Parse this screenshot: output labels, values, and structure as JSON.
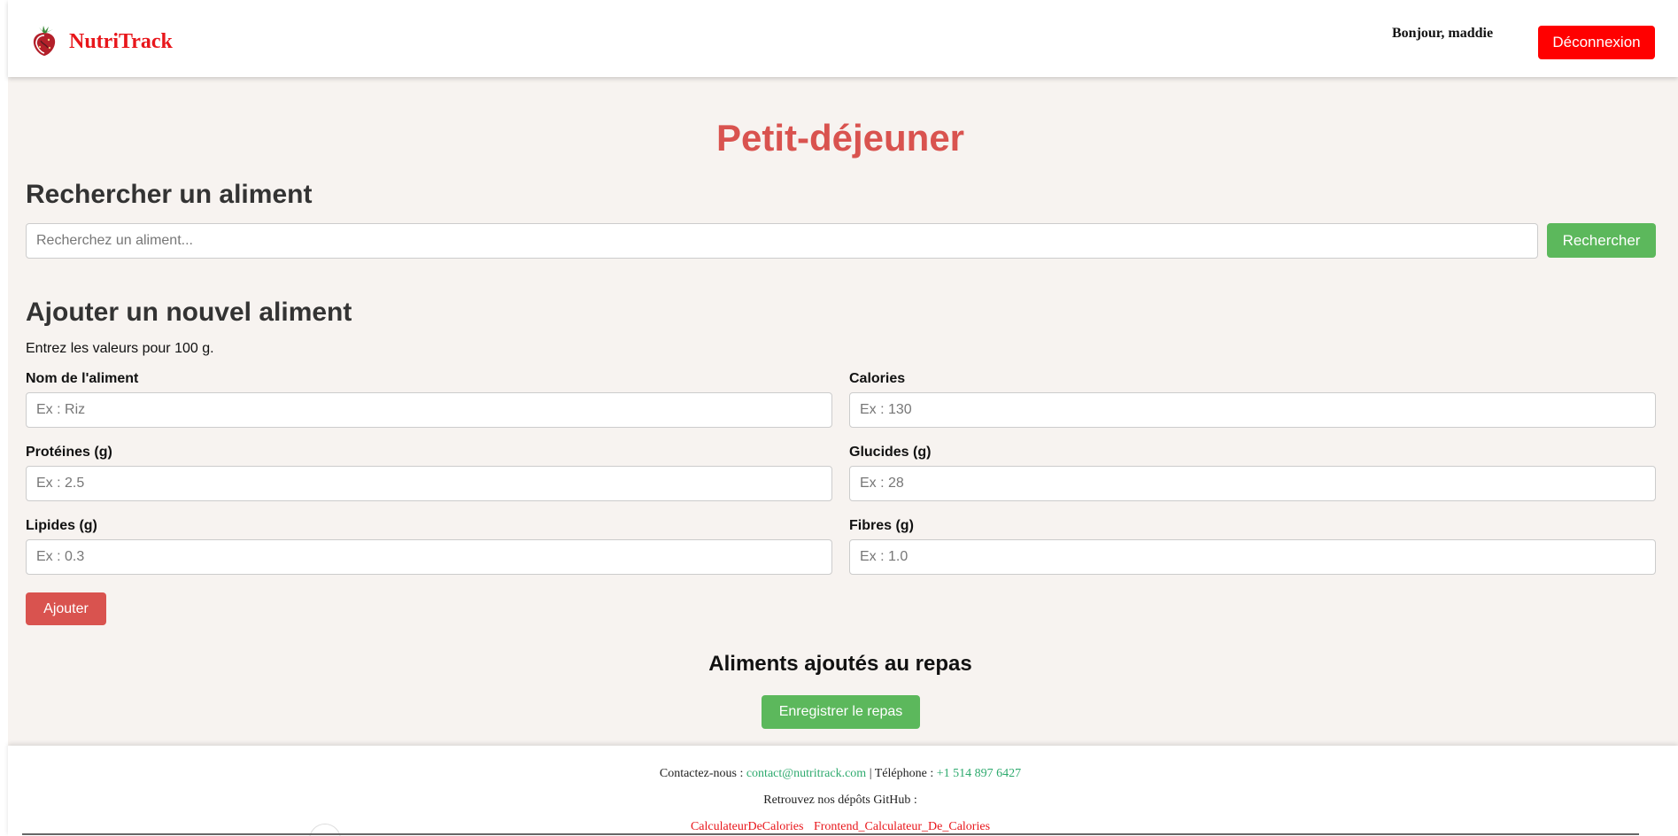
{
  "header": {
    "brand": "NutriTrack",
    "greeting": "Bonjour, maddie",
    "logout_label": "Déconnexion",
    "colors": {
      "brand": "#e8161b",
      "logout": "#ff0000"
    }
  },
  "main": {
    "meal_title": "Petit-déjeuner",
    "search": {
      "title": "Rechercher un aliment",
      "placeholder": "Recherchez un aliment...",
      "value": "",
      "button_label": "Rechercher"
    },
    "add_food": {
      "title": "Ajouter un nouvel aliment",
      "hint": "Entrez les valeurs pour 100 g.",
      "fields": [
        {
          "label": "Nom de l'aliment",
          "placeholder": "Ex : Riz",
          "value": ""
        },
        {
          "label": "Calories",
          "placeholder": "Ex : 130",
          "value": ""
        },
        {
          "label": "Protéines (g)",
          "placeholder": "Ex : 2.5",
          "value": ""
        },
        {
          "label": "Glucides (g)",
          "placeholder": "Ex : 28",
          "value": ""
        },
        {
          "label": "Lipides (g)",
          "placeholder": "Ex : 0.3",
          "value": ""
        },
        {
          "label": "Fibres (g)",
          "placeholder": "Ex : 1.0",
          "value": ""
        }
      ],
      "add_button_label": "Ajouter"
    },
    "meal_items": {
      "title": "Aliments ajoutés au repas",
      "items": [],
      "save_button_label": "Enregistrer le repas"
    },
    "colors": {
      "title": "#d9534f",
      "primary_green": "#5cb85c",
      "danger": "#d9534f"
    }
  },
  "footer": {
    "contact_prefix": "Contactez-nous :",
    "email": "contact@nutritrack.com",
    "separator": "| Téléphone :",
    "phone": "+1 514 897 6427",
    "github_text": "Retrouvez nos dépôts GitHub :",
    "repos": [
      "CalculateurDeCalories",
      "Frontend_Calculateur_De_Calories"
    ]
  }
}
